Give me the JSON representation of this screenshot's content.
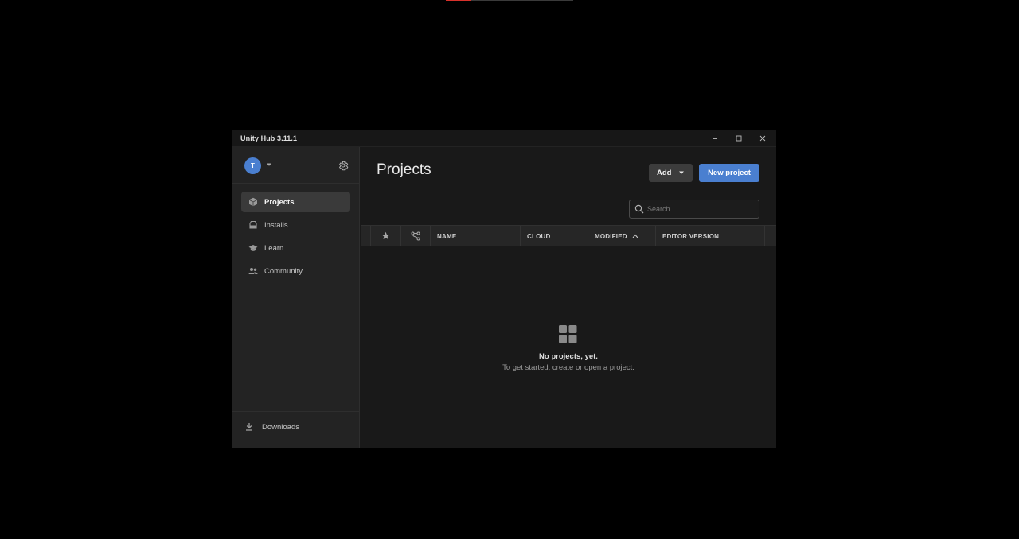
{
  "window": {
    "title": "Unity Hub 3.11.1"
  },
  "sidebar": {
    "avatar_initial": "T",
    "items": [
      {
        "label": "Projects",
        "icon": "cube-icon",
        "active": true
      },
      {
        "label": "Installs",
        "icon": "installs-icon",
        "active": false
      },
      {
        "label": "Learn",
        "icon": "graduation-cap-icon",
        "active": false
      },
      {
        "label": "Community",
        "icon": "people-icon",
        "active": false
      }
    ],
    "downloads_label": "Downloads"
  },
  "main": {
    "title": "Projects",
    "add_label": "Add",
    "new_project_label": "New project",
    "search_placeholder": "Search...",
    "columns": {
      "name": "NAME",
      "cloud": "CLOUD",
      "modified": "MODIFIED",
      "editor_version": "EDITOR VERSION"
    },
    "empty_title": "No projects, yet.",
    "empty_subtitle": "To get started, create or open a project."
  },
  "colors": {
    "accent": "#4a7fd0",
    "window_bg": "#191919",
    "sidebar_bg": "#232323"
  }
}
